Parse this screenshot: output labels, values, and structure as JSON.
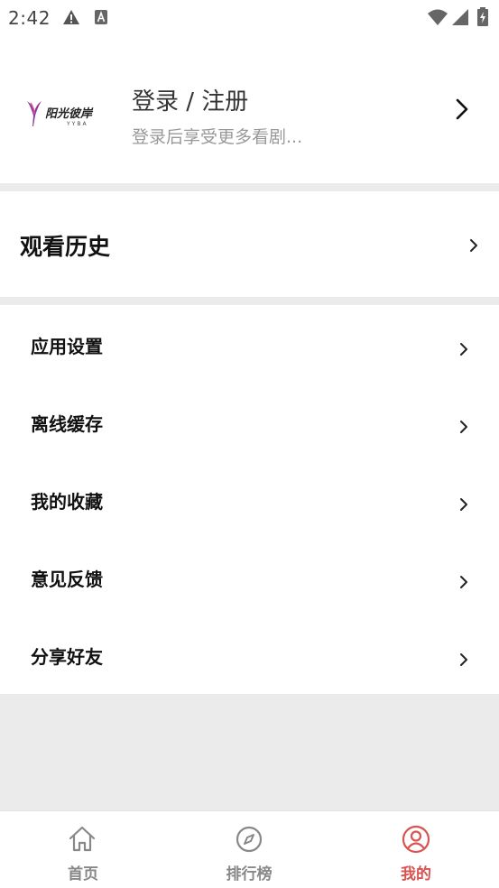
{
  "status_bar": {
    "time": "2:42"
  },
  "login": {
    "logo_text": "阳光彼岸",
    "logo_sub": "YYBA",
    "title": "登录 / 注册",
    "subtitle": "登录后享受更多看剧..."
  },
  "history": {
    "title": "观看历史"
  },
  "menu": {
    "items": [
      {
        "label": "应用设置"
      },
      {
        "label": "离线缓存"
      },
      {
        "label": "我的收藏"
      },
      {
        "label": "意见反馈"
      },
      {
        "label": "分享好友"
      }
    ]
  },
  "tabs": [
    {
      "label": "首页",
      "icon": "home-icon",
      "active": false
    },
    {
      "label": "排行榜",
      "icon": "compass-icon",
      "active": false
    },
    {
      "label": "我的",
      "icon": "profile-icon",
      "active": true
    }
  ],
  "colors": {
    "accent": "#d9534f",
    "inactive": "#888888",
    "background": "#ebebeb"
  }
}
